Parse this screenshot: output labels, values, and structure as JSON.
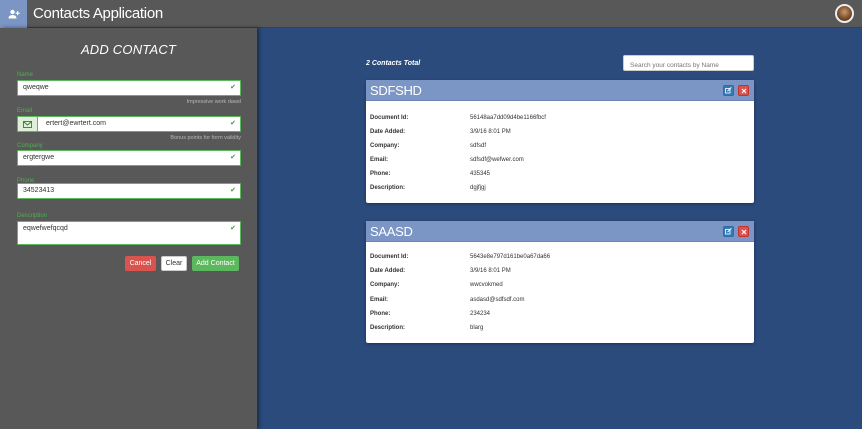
{
  "app": {
    "title": "Contacts Application"
  },
  "sidebar": {
    "title": "ADD CONTACT",
    "fields": [
      {
        "label": "Name",
        "value": "qweqwe",
        "hint": "Impressive work dawd"
      },
      {
        "label": "Email",
        "value": "ertert@ewrtert.com",
        "hint": "Bonus points for form validity"
      },
      {
        "label": "Company",
        "value": "ergtergwe"
      },
      {
        "label": "Phone",
        "value": "34523413"
      },
      {
        "label": "Description",
        "value": "eqwefwefqcqd"
      }
    ],
    "buttons": {
      "cancel": "Cancel",
      "clear": "Clear",
      "add": "Add Contact"
    }
  },
  "main": {
    "total": "2 Contacts Total",
    "search_placeholder": "Search your contacts by Name",
    "field_labels": {
      "doc_id": "Document Id:",
      "date_added": "Date Added:",
      "company": "Company:",
      "email": "Email:",
      "phone": "Phone:",
      "description": "Description:"
    },
    "contacts": [
      {
        "name": "SDFSHD",
        "doc_id": "56148aa7dd09d4be1166fbcf",
        "date_added": "3/9/16 8:01 PM",
        "company": "sdfsdf",
        "email": "sdfsdf@wefwer.com",
        "phone": "435345",
        "description": "dgjfjgj"
      },
      {
        "name": "SAASD",
        "doc_id": "5643e8e797d161be0a67da66",
        "date_added": "3/9/16 8:01 PM",
        "company": "wwcvokmed",
        "email": "asdasd@sdfsdf.com",
        "phone": "234234",
        "description": "blarg"
      }
    ]
  },
  "colors": {
    "sidebar": "#585858",
    "main": "#2b4b7d",
    "card_header": "#7b95c5",
    "success": "#5cb85c",
    "danger": "#d9534f",
    "primary": "#337ab7"
  },
  "icons": {
    "logo": "user-plus-icon",
    "email_addon": "envelope-icon",
    "valid": "check-icon",
    "edit": "edit-icon",
    "delete": "close-icon"
  }
}
